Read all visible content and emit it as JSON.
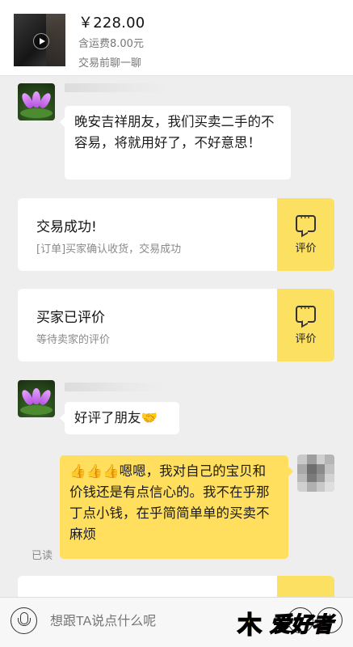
{
  "product": {
    "price": "￥228.00",
    "shipping": "含运费8.00元",
    "chat_before": "交易前聊一聊"
  },
  "messages": [
    {
      "from": "other",
      "text": "晚安吉祥朋友，我们买卖二手的不容易，将就用好了，不好意思！"
    },
    {
      "from": "other",
      "text": "好评了朋友🤝"
    },
    {
      "from": "me",
      "text": "👍👍👍嗯嗯，我对自己的宝贝和价钱还是有点信心的。我不在乎那丁点小钱，在乎简简单单的买卖不麻烦"
    }
  ],
  "cards": [
    {
      "title": "交易成功!",
      "subtitle": "[订单]买家确认收货，交易成功",
      "action": "评价"
    },
    {
      "title": "买家已评价",
      "subtitle": "等待卖家的评价",
      "action": "评价"
    }
  ],
  "read_status": "已读",
  "input": {
    "placeholder": "想跟TA说点什么呢"
  },
  "watermark": {
    "left": "木",
    "right": "爱好者"
  },
  "icons": [
    "play-icon",
    "microphone-icon",
    "emoji-icon",
    "plus-icon",
    "comment-icon"
  ],
  "colors": {
    "accent": "#ffdf5d",
    "card_button": "#fbe061",
    "background": "#eeeeee"
  }
}
